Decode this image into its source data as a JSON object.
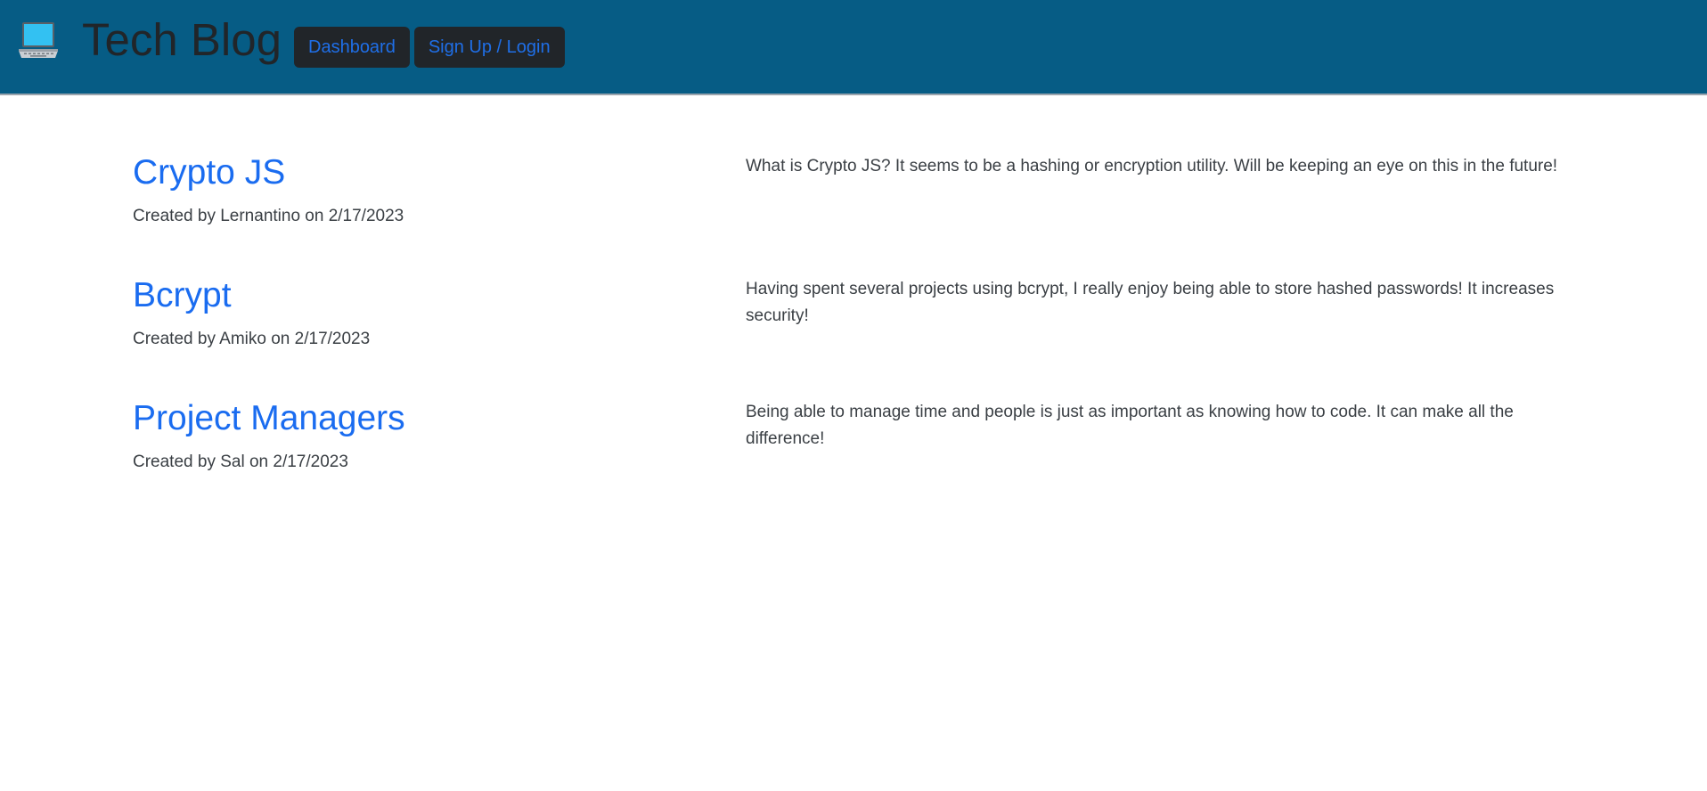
{
  "header": {
    "icon": "laptop-icon",
    "title": "Tech Blog",
    "nav": [
      {
        "label": "Dashboard"
      },
      {
        "label": "Sign Up / Login"
      }
    ],
    "background_color": "#065c85",
    "link_color": "#1f6fe8"
  },
  "posts": [
    {
      "title": "Crypto JS",
      "meta": "Created by Lernantino on 2/17/2023",
      "body": "What is Crypto JS? It seems to be a hashing or encryption utility. Will be keeping an eye on this in the future!"
    },
    {
      "title": "Bcrypt",
      "meta": "Created by Amiko on 2/17/2023",
      "body": "Having spent several projects using bcrypt, I really enjoy being able to store hashed passwords! It increases security!"
    },
    {
      "title": "Project Managers",
      "meta": "Created by Sal on 2/17/2023",
      "body": "Being able to manage time and people is just as important as knowing how to code. It can make all the difference!"
    }
  ]
}
